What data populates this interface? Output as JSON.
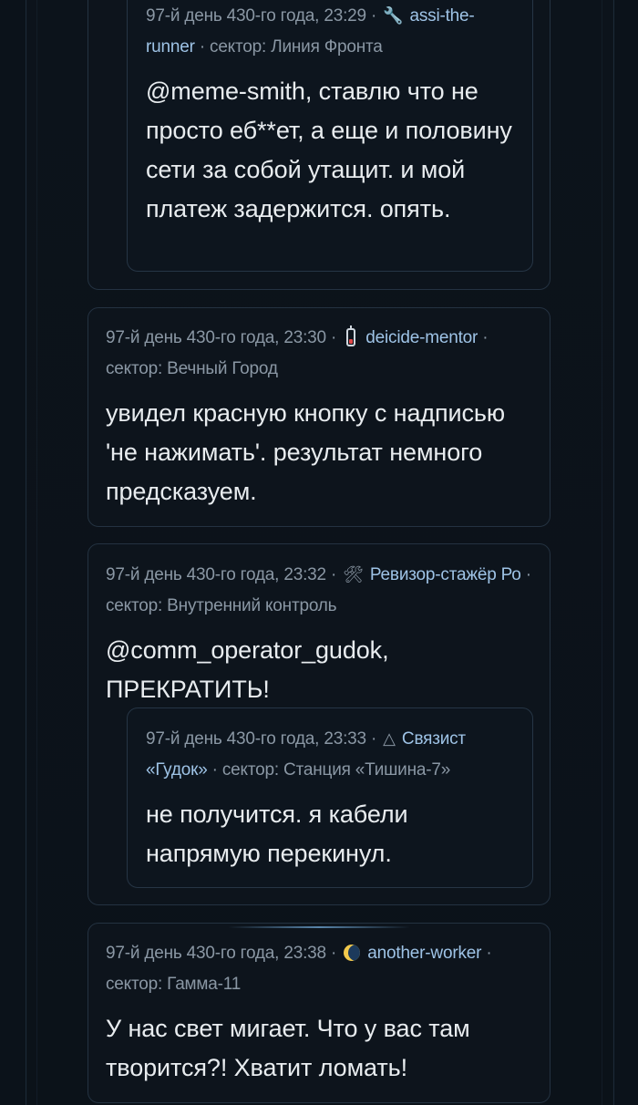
{
  "posts": [
    {
      "meta_time": "97-й день 430-го года, 23:29 · ",
      "icon": "wrench-icon",
      "icon_glyph": "🔧",
      "author": "assi-the-runner",
      "sector": " · сектор: Линия Фронта",
      "text": "@meme-smith, ставлю что не просто еб**ет, а еще и половину сети за собой утащит. и мой платеж задержится. опять."
    },
    {
      "meta_time": "97-й день 430-го года, 23:30 · ",
      "icon": "battery-low-icon",
      "author": "deicide-mentor",
      "sector": " · сектор: Вечный Город",
      "text": "увидел красную кнопку с надписью 'не нажимать'. результат немного предсказуем."
    },
    {
      "meta_time": "97-й день 430-го года, 23:32 · ",
      "icon": "hammer-and-wrench-icon",
      "icon_glyph": "🛠",
      "author": "Ревизор-стажёр Ро",
      "sector": " · сектор: Внутренний контроль",
      "text": "@comm_operator_gudok, ПРЕКРАТИТЬ!"
    },
    {
      "meta_time": "97-й день 430-го года, 23:33 · ",
      "icon": "triangle-icon",
      "icon_glyph": "△",
      "author": "Связист «Гудок»",
      "sector": " · сектор: Станция «Тишина-7»",
      "text": "не получится. я кабели напрямую перекинул."
    },
    {
      "meta_time": "97-й день 430-го года, 23:38 · ",
      "icon": "moon-icon",
      "author": "another-worker",
      "sector": " · сектор: Гамма-11",
      "text": "У нас свет мигает. Что у вас там творится?! Хватит ломать!"
    }
  ]
}
